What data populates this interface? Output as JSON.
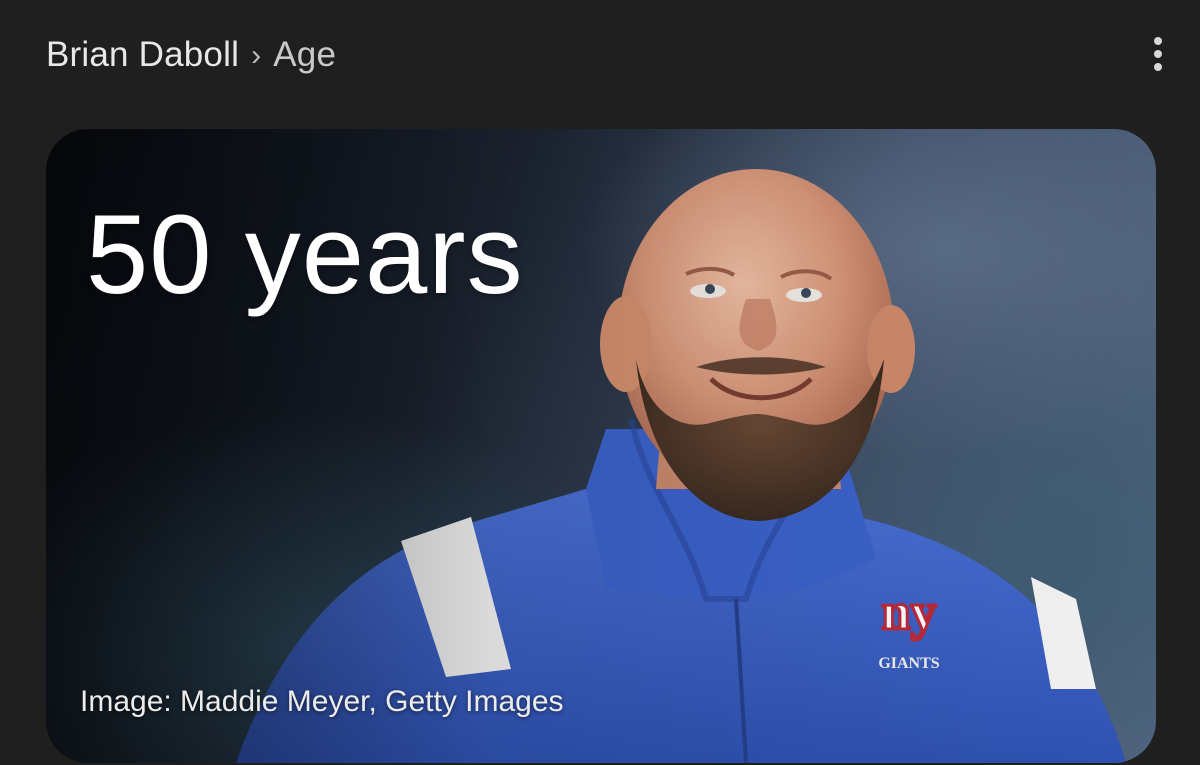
{
  "breadcrumb": {
    "entity": "Brian Daboll",
    "separator": "›",
    "attribute": "Age"
  },
  "more_menu": {
    "icon": "more-vert-icon"
  },
  "answer_card": {
    "value": "50 years",
    "image_credit": "Image: Maddie Meyer, Getty Images",
    "logo_text": "ny",
    "logo_subtext": "GIANTS"
  },
  "colors": {
    "background": "#1f1f1f",
    "jacket_blue": "#3a5fc6",
    "logo_red": "#b5283a",
    "text_primary": "#ffffff"
  }
}
